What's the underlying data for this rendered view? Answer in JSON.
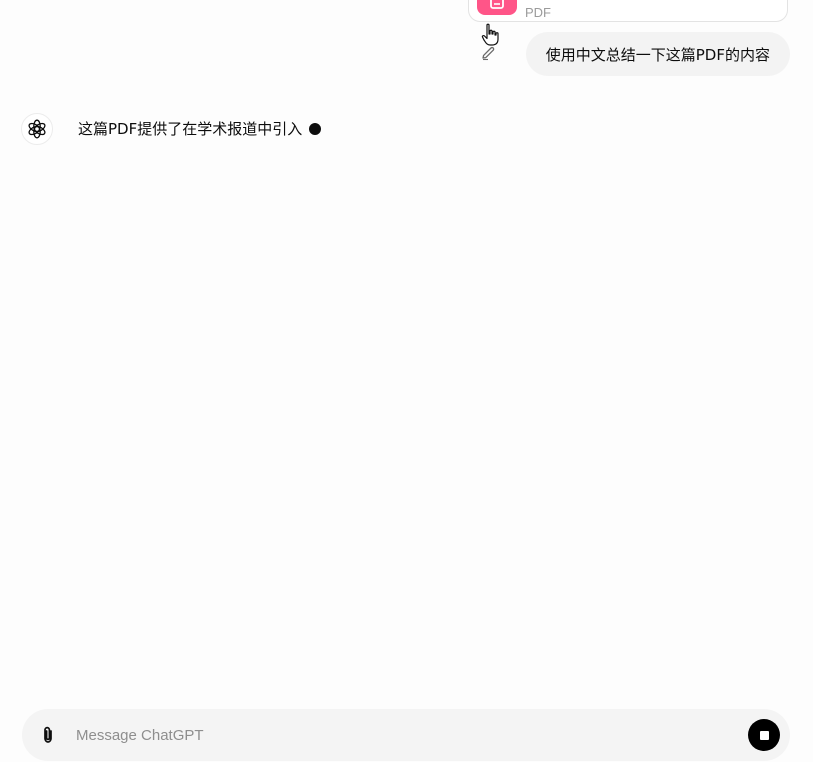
{
  "attachment": {
    "type_label": "PDF",
    "icon": "document-icon",
    "icon_color": "#ff5588"
  },
  "user_message": {
    "text": "使用中文总结一下这篇PDF的内容",
    "edit_icon": "pencil-icon"
  },
  "assistant_message": {
    "avatar_icon": "openai-logo-icon",
    "text": "这篇PDF提供了在学术报道中引入",
    "streaming_indicator": "typing-dot"
  },
  "composer": {
    "placeholder": "Message ChatGPT",
    "value": "",
    "attach_icon": "paperclip-icon",
    "stop_icon": "stop-icon"
  },
  "colors": {
    "background": "#fdfdfd",
    "bubble": "#f3f3f3",
    "composer": "#f4f4f4",
    "text": "#0d0d0d"
  }
}
